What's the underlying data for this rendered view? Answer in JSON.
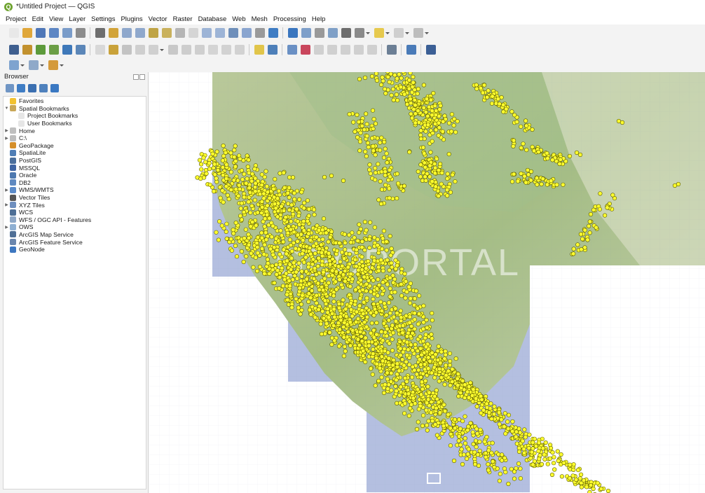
{
  "window": {
    "title": "*Untitled Project — QGIS",
    "logo_letter": "Q"
  },
  "menubar": {
    "items": [
      "Project",
      "Edit",
      "View",
      "Layer",
      "Settings",
      "Plugins",
      "Vector",
      "Raster",
      "Database",
      "Web",
      "Mesh",
      "Processing",
      "Help"
    ]
  },
  "toolbars": {
    "row1": [
      {
        "icon": "new-project-icon",
        "color": "#e8e8e8"
      },
      {
        "icon": "open-project-icon",
        "color": "#e0a73a"
      },
      {
        "icon": "save-project-icon",
        "color": "#4f77b8"
      },
      {
        "icon": "save-as-icon",
        "color": "#5d86c4"
      },
      {
        "icon": "print-layout-icon",
        "color": "#7a9cc9"
      },
      {
        "icon": "style-manager-icon",
        "color": "#8c8c8c"
      },
      {
        "sep": true
      },
      {
        "icon": "pan-icon",
        "color": "#6e6e6e"
      },
      {
        "icon": "pan-to-selection-icon",
        "color": "#d2a43a"
      },
      {
        "icon": "zoom-in-icon",
        "color": "#8fa8cc"
      },
      {
        "icon": "zoom-out-icon",
        "color": "#8fa8cc"
      },
      {
        "icon": "zoom-full-icon",
        "color": "#bfa446"
      },
      {
        "icon": "zoom-selection-icon",
        "color": "#c9b15c"
      },
      {
        "icon": "zoom-layer-icon",
        "color": "#b5b5b5"
      },
      {
        "icon": "zoom-native-icon",
        "color": "#d5d5d5"
      },
      {
        "icon": "zoom-last-icon",
        "color": "#9db4d6"
      },
      {
        "icon": "zoom-next-icon",
        "color": "#9db4d6"
      },
      {
        "icon": "new-bookmark-icon",
        "color": "#6f8fba"
      },
      {
        "icon": "show-bookmarks-icon",
        "color": "#8aa5cf"
      },
      {
        "icon": "temporal-controller-icon",
        "color": "#9a9a9a"
      },
      {
        "icon": "refresh-icon",
        "color": "#3f7dc4"
      },
      {
        "sep": true
      },
      {
        "icon": "identify-icon",
        "color": "#3a76bf"
      },
      {
        "icon": "attribute-table-icon",
        "color": "#7e9fc9"
      },
      {
        "icon": "field-calculator-icon",
        "color": "#999999"
      },
      {
        "icon": "statistics-icon",
        "color": "#7fa0c7"
      },
      {
        "icon": "sum-icon",
        "color": "#6d6d6d"
      },
      {
        "icon": "measure-icon",
        "color": "#8a8a8a",
        "dropdown": true
      },
      {
        "icon": "annotation-icon",
        "color": "#e6c94e",
        "dropdown": true
      },
      {
        "icon": "map-tips-icon",
        "color": "#cfcfcf",
        "dropdown": true
      },
      {
        "icon": "text-annotation-icon",
        "color": "#bdbdbd",
        "dropdown": true
      }
    ],
    "row2": [
      {
        "icon": "digitizing-icon",
        "color": "#3f5f8f"
      },
      {
        "icon": "add-layer-icon",
        "color": "#c2912e"
      },
      {
        "icon": "add-vector-icon",
        "color": "#5c9a3b"
      },
      {
        "icon": "add-raster-icon",
        "color": "#6b9e46"
      },
      {
        "icon": "add-delimited-icon",
        "color": "#3e78b9"
      },
      {
        "icon": "new-shapefile-icon",
        "color": "#5b86b8"
      },
      {
        "sep": true
      },
      {
        "icon": "toggle-editing-icon",
        "color": "#d8d8d8"
      },
      {
        "icon": "edit-pencil-icon",
        "color": "#c9a23a"
      },
      {
        "icon": "save-edits-icon",
        "color": "#c3c3c3"
      },
      {
        "icon": "add-feature-icon",
        "color": "#cfcfcf"
      },
      {
        "icon": "vertex-tool-icon",
        "color": "#d0d0d0",
        "dropdown": true
      },
      {
        "icon": "delete-selected-icon",
        "color": "#c8c8c8"
      },
      {
        "icon": "cut-features-icon",
        "color": "#cdcdcd"
      },
      {
        "icon": "copy-features-icon",
        "color": "#cfcfcf"
      },
      {
        "icon": "paste-features-icon",
        "color": "#d4d4d4"
      },
      {
        "icon": "undo-icon",
        "color": "#d2d2d2"
      },
      {
        "icon": "redo-icon",
        "color": "#d2d2d2"
      },
      {
        "sep": true
      },
      {
        "icon": "label-toolbar-icon",
        "color": "#e1c54a"
      },
      {
        "icon": "layer-labeling-icon",
        "color": "#4d7fb9"
      },
      {
        "sep": true
      },
      {
        "icon": "pin-labels-icon",
        "color": "#6a90c4"
      },
      {
        "icon": "highlight-labels-icon",
        "color": "#c9465c"
      },
      {
        "icon": "move-label-icon",
        "color": "#d0d0d0"
      },
      {
        "icon": "rotate-label-icon",
        "color": "#d0d0d0"
      },
      {
        "icon": "change-label-icon",
        "color": "#d0d0d0"
      },
      {
        "icon": "show-hide-labels-icon",
        "color": "#d0d0d0"
      },
      {
        "icon": "label-properties-icon",
        "color": "#d0d0d0"
      },
      {
        "sep": true
      },
      {
        "icon": "plugins-icon",
        "color": "#6c7f95"
      },
      {
        "sep": true
      },
      {
        "icon": "python-console-icon",
        "color": "#4a7bb8"
      },
      {
        "sep": true
      },
      {
        "icon": "processing-toolbox-icon",
        "color": "#3b5f95"
      }
    ],
    "row3": [
      {
        "icon": "data-source-manager-icon",
        "color": "#7ea3cf",
        "dropdown": true
      },
      {
        "icon": "new-layer-icon",
        "color": "#8fa9c9",
        "dropdown": true
      },
      {
        "icon": "virtual-layer-icon",
        "color": "#d49a3b",
        "dropdown": true
      }
    ]
  },
  "browser": {
    "title": "Browser",
    "toolbar_icons": [
      {
        "icon": "add-selected-layers-icon",
        "color": "#6f95c4"
      },
      {
        "icon": "refresh-icon",
        "color": "#3f7dc4"
      },
      {
        "icon": "filter-icon",
        "color": "#3b6fb0"
      },
      {
        "icon": "collapse-all-icon",
        "color": "#4f81bd"
      },
      {
        "icon": "properties-icon",
        "color": "#3a78c2"
      }
    ],
    "items": [
      {
        "label": "Favorites",
        "icon": "favorites-icon",
        "color": "#f2c230",
        "arrow": "",
        "indent": 0
      },
      {
        "label": "Spatial Bookmarks",
        "icon": "spatial-bookmarks-icon",
        "color": "#c9a757",
        "arrow": "▼",
        "indent": 0
      },
      {
        "label": "Project Bookmarks",
        "icon": "project-bookmarks-icon",
        "color": "#e6e6e6",
        "arrow": "",
        "indent": 1
      },
      {
        "label": "User Bookmarks",
        "icon": "user-bookmarks-icon",
        "color": "#e6e6e6",
        "arrow": "",
        "indent": 1
      },
      {
        "label": "Home",
        "icon": "home-folder-icon",
        "color": "#bfbfbf",
        "arrow": "▶",
        "indent": 0
      },
      {
        "label": "C:\\",
        "icon": "drive-icon",
        "color": "#bdbdbd",
        "arrow": "▶",
        "indent": 0
      },
      {
        "label": "GeoPackage",
        "icon": "geopackage-icon",
        "color": "#d58f2a",
        "arrow": "",
        "indent": 0
      },
      {
        "label": "SpatiaLite",
        "icon": "spatialite-icon",
        "color": "#4e7db5",
        "arrow": "",
        "indent": 0
      },
      {
        "label": "PostGIS",
        "icon": "postgis-icon",
        "color": "#4a6e9c",
        "arrow": "",
        "indent": 0
      },
      {
        "label": "MSSQL",
        "icon": "mssql-icon",
        "color": "#3e64a3",
        "arrow": "",
        "indent": 0
      },
      {
        "label": "Oracle",
        "icon": "oracle-icon",
        "color": "#4e79b0",
        "arrow": "",
        "indent": 0
      },
      {
        "label": "DB2",
        "icon": "db2-icon",
        "color": "#5f89c0",
        "arrow": "",
        "indent": 0
      },
      {
        "label": "WMS/WMTS",
        "icon": "wms-icon",
        "color": "#5b8bc9",
        "arrow": "▶",
        "indent": 0
      },
      {
        "label": "Vector Tiles",
        "icon": "vector-tiles-icon",
        "color": "#555555",
        "arrow": "",
        "indent": 0
      },
      {
        "label": "XYZ Tiles",
        "icon": "xyz-tiles-icon",
        "color": "#6e8fbf",
        "arrow": "▶",
        "indent": 0
      },
      {
        "label": "WCS",
        "icon": "wcs-icon",
        "color": "#4e6f96",
        "arrow": "",
        "indent": 0
      },
      {
        "label": "WFS / OGC API - Features",
        "icon": "wfs-icon",
        "color": "#8fa8c7",
        "arrow": "",
        "indent": 0
      },
      {
        "label": "OWS",
        "icon": "ows-icon",
        "color": "#8fb0d3",
        "arrow": "▶",
        "indent": 0
      },
      {
        "label": "ArcGIS Map Service",
        "icon": "arcgis-map-service-icon",
        "color": "#4f6f96",
        "arrow": "",
        "indent": 0
      },
      {
        "label": "ArcGIS Feature Service",
        "icon": "arcgis-feature-service-icon",
        "color": "#6a86ad",
        "arrow": "",
        "indent": 0
      },
      {
        "label": "GeoNode",
        "icon": "geonode-icon",
        "color": "#3d77c0",
        "arrow": "",
        "indent": 0
      }
    ]
  },
  "map": {
    "watermark": "GEOPORTAL",
    "colors": {
      "land_green": "#a9c08f",
      "land_light": "#cfd9b8",
      "sea_blue": "#b4bfe0",
      "point_fill": "#ffff2e",
      "point_stroke": "#5a5a00"
    }
  }
}
